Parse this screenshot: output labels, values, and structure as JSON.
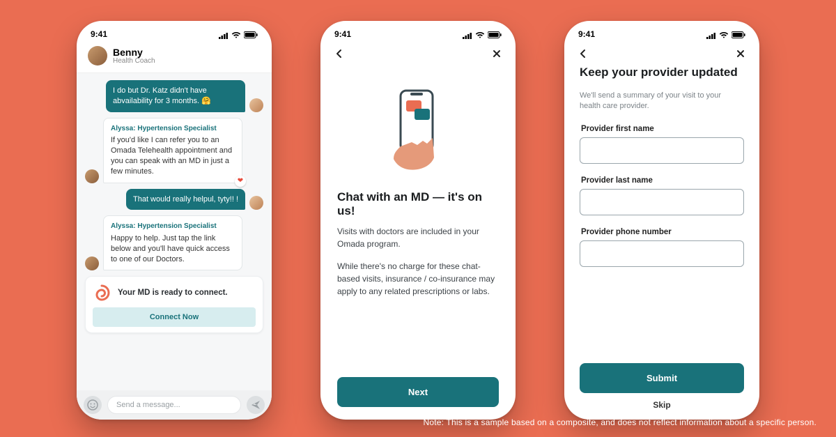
{
  "status": {
    "time": "9:41",
    "signal_icon": "signal-icon",
    "wifi_icon": "wifi-icon",
    "battery_icon": "battery-icon"
  },
  "phone1": {
    "header": {
      "name": "Benny",
      "role": "Health Coach"
    },
    "messages": [
      {
        "type": "user",
        "text": "I do but Dr. Katz didn't have abvailability for 3 months. 🤗"
      },
      {
        "type": "coach",
        "name": "Alyssa: Hypertension Specialist",
        "text": "If you'd like I can refer you to an Omada Telehealth appointment and you can speak with an MD in just a few minutes.",
        "heart": true
      },
      {
        "type": "user",
        "text": "That would really helpul, tyty!! !"
      },
      {
        "type": "coach",
        "name": "Alyssa: Hypertension Specialist",
        "text": "Happy to help. Just tap the link below and you'll have quick access to one of our Doctors."
      }
    ],
    "md_card": {
      "text": "Your MD is ready to connect.",
      "button": "Connect Now"
    },
    "composer": {
      "placeholder": "Send a message..."
    }
  },
  "phone2": {
    "title": "Chat with an MD — it's on us!",
    "p1": "Visits with doctors are included in your Omada program.",
    "p2": "While there's no charge for these chat-based visits, insurance / co-insurance may apply to any related prescriptions or labs.",
    "button": "Next"
  },
  "phone3": {
    "title": "Keep your provider updated",
    "sub": "We'll send a summary of your visit to your health care provider.",
    "f1": "Provider first name",
    "f2": "Provider last name",
    "f3": "Provider phone number",
    "submit": "Submit",
    "skip": "Skip"
  },
  "disclaimer": "Note:  This is a sample based on a composite, and does not reflect information about a specific person."
}
